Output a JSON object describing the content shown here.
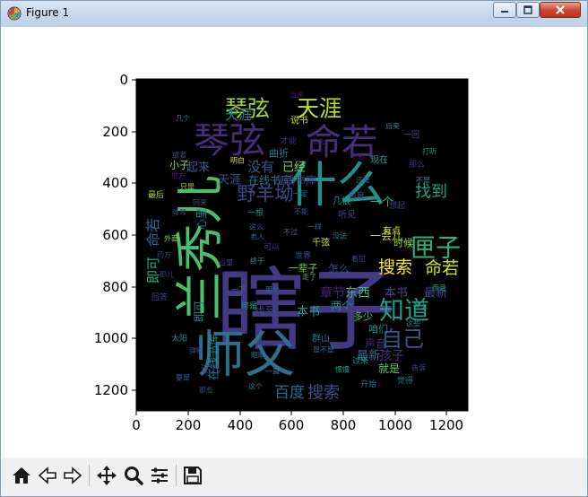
{
  "window": {
    "title": "Figure 1"
  },
  "plot": {
    "x_ticks": [
      "0",
      "200",
      "400",
      "600",
      "800",
      "1000",
      "1200"
    ],
    "y_ticks": [
      "0",
      "200",
      "400",
      "600",
      "800",
      "1000",
      "1200"
    ],
    "background": "#000000"
  },
  "toolbar": {
    "icons": [
      "home-icon",
      "back-arrow-icon",
      "forward-arrow-icon",
      "pan-icon",
      "zoom-icon",
      "configure-subplots-icon",
      "save-icon"
    ]
  },
  "wordcloud": {
    "words": [
      {
        "text": "瞎子",
        "color": "#443a83"
      },
      {
        "text": "师父",
        "color": "#2c728e"
      },
      {
        "text": "兰秀儿",
        "color": "#48c16e"
      },
      {
        "text": "什么",
        "color": "#21918c"
      },
      {
        "text": "琴弦",
        "color": "#472c7a"
      },
      {
        "text": "命若",
        "color": "#472d7b"
      },
      {
        "text": "琴弦",
        "color": "#a0da39"
      },
      {
        "text": "天涯",
        "color": "#c2df23"
      },
      {
        "text": "匣子",
        "color": "#2db27d"
      },
      {
        "text": "知道",
        "color": "#1f9e89"
      },
      {
        "text": "自己",
        "color": "#38588c"
      },
      {
        "text": "野羊坳",
        "color": "#3e4989"
      },
      {
        "text": "搜索",
        "color": "#fde725"
      },
      {
        "text": "命若",
        "color": "#d2e21b"
      },
      {
        "text": "没有",
        "color": "#365c8d"
      },
      {
        "text": "百度",
        "color": "#31688e"
      },
      {
        "text": "搜索",
        "color": "#3b528b"
      },
      {
        "text": "天涯",
        "color": "#26828e"
      },
      {
        "text": "命若",
        "color": "#32658e"
      },
      {
        "text": "在线书库",
        "color": "#2a788e"
      },
      {
        "text": "找到",
        "color": "#1fa187"
      },
      {
        "text": "本书",
        "color": "#404688"
      },
      {
        "text": "最新",
        "color": "#414487"
      },
      {
        "text": "章节",
        "color": "#482475"
      },
      {
        "text": "东西",
        "color": "#35b779"
      },
      {
        "text": "孩子",
        "color": "#46337e"
      },
      {
        "text": "一个",
        "color": "#2fb47c"
      },
      {
        "text": "即可",
        "color": "#27ad81"
      },
      {
        "text": "找到",
        "color": "#3f4788"
      },
      {
        "text": "本书",
        "color": "#1e9b8a"
      },
      {
        "text": "起来",
        "color": "#365d8d"
      },
      {
        "text": "天涯",
        "color": "#3a548c"
      },
      {
        "text": "在线书库",
        "color": "#25838e"
      },
      {
        "text": "已经",
        "color": "#7ad151"
      },
      {
        "text": "在线书库",
        "color": "#46307e"
      },
      {
        "text": "最新",
        "color": "#2e6f8e"
      },
      {
        "text": "一会儿",
        "color": "#bddf26"
      },
      {
        "text": "时候",
        "color": "#94d840"
      },
      {
        "text": "怎么",
        "color": "#3d4d8a"
      },
      {
        "text": "两个",
        "color": "#23898e"
      },
      {
        "text": "多少",
        "color": "#52c569"
      },
      {
        "text": "咱们",
        "color": "#1f948c"
      },
      {
        "text": "就是",
        "color": "#5ec962"
      },
      {
        "text": "声音",
        "color": "#482878"
      },
      {
        "text": "心里",
        "color": "#26818e"
      },
      {
        "text": "一辈子",
        "color": "#6ccd5a"
      },
      {
        "text": "曲折",
        "color": "#2a768e"
      },
      {
        "text": "这儿",
        "color": "#3e4a89"
      },
      {
        "text": "有点",
        "color": "#e7e419"
      },
      {
        "text": "一根",
        "color": "#20928c"
      },
      {
        "text": "现在",
        "color": "#1f978b"
      },
      {
        "text": "千弦",
        "color": "#dfe318"
      },
      {
        "text": "听见",
        "color": "#3f4889"
      },
      {
        "text": "想起",
        "color": "#443b84"
      },
      {
        "text": "小子",
        "color": "#89d548"
      },
      {
        "text": "说书",
        "color": "#b2dd2d"
      },
      {
        "text": "几根",
        "color": "#1f988b"
      },
      {
        "text": "一回",
        "color": "#3d4e8a"
      },
      {
        "text": "那么",
        "color": "#46327e"
      },
      {
        "text": "即可",
        "color": "#238a8d"
      },
      {
        "text": "群山",
        "color": "#2b758e"
      },
      {
        "text": "世界",
        "color": "#3b528b"
      },
      {
        "text": "才能",
        "color": "#472a7a"
      },
      {
        "text": "回答",
        "color": "#404588"
      },
      {
        "text": "可是",
        "color": "#1fa188"
      },
      {
        "text": "最后",
        "color": "#a8db34"
      },
      {
        "text": "太阳",
        "color": "#25858e"
      },
      {
        "text": "百度",
        "color": "#3e4c8a"
      },
      {
        "text": "过来",
        "color": "#1e9c89"
      },
      {
        "text": "开始",
        "color": "#2c728e"
      },
      {
        "text": "觉得",
        "color": "#29798e"
      },
      {
        "text": "可以",
        "color": "#472f7d"
      },
      {
        "text": "这么",
        "color": "#32648e"
      },
      {
        "text": "不能",
        "color": "#3c4f8a"
      },
      {
        "text": "这些",
        "color": "#238a8d"
      },
      {
        "text": "而且",
        "color": "#21a685"
      },
      {
        "text": "不过",
        "color": "#2e6e8e"
      },
      {
        "text": "要是",
        "color": "#355f8d"
      },
      {
        "text": "那儿",
        "color": "#453781"
      },
      {
        "text": "还是",
        "color": "#3b528b"
      },
      {
        "text": "不是",
        "color": "#1f958b"
      },
      {
        "text": "只是",
        "color": "#9bd93c"
      },
      {
        "text": "终于",
        "color": "#20a386"
      },
      {
        "text": "总之",
        "color": "#46337f"
      },
      {
        "text": "弹断",
        "color": "#3a548c"
      },
      {
        "text": "眼睛",
        "color": "#2d708e"
      },
      {
        "text": "晚上",
        "color": "#1fa088"
      },
      {
        "text": "山里",
        "color": "#3c4f8a"
      },
      {
        "text": "老人",
        "color": "#31668e"
      },
      {
        "text": "一样",
        "color": "#2b758e"
      },
      {
        "text": "没法",
        "color": "#27808e"
      },
      {
        "text": "地方",
        "color": "#481f70"
      },
      {
        "text": "走了",
        "color": "#4ac16d"
      },
      {
        "text": "慢慢",
        "color": "#22a884"
      },
      {
        "text": "看见",
        "color": "#3f4788"
      },
      {
        "text": "一定",
        "color": "#2c738e"
      },
      {
        "text": "明白",
        "color": "#d8e219"
      },
      {
        "text": "那个",
        "color": "#2a768e"
      },
      {
        "text": "药方",
        "color": "#404688"
      },
      {
        "text": "几个",
        "color": "#228c8d"
      },
      {
        "text": "出来",
        "color": "#471063"
      },
      {
        "text": "一下",
        "color": "#2d708e"
      },
      {
        "text": "回来",
        "color": "#3b528b"
      },
      {
        "text": "这个",
        "color": "#24868e"
      },
      {
        "text": "或者",
        "color": "#3d4d8a"
      },
      {
        "text": "那些",
        "color": "#3e4a89"
      },
      {
        "text": "打听",
        "color": "#1e9b8a"
      },
      {
        "text": "不知",
        "color": "#482677"
      },
      {
        "text": "后来",
        "color": "#25848e"
      },
      {
        "text": "外面",
        "color": "#7fd34e"
      },
      {
        "text": "一直",
        "color": "#287c8e"
      },
      {
        "text": "弹琴",
        "color": "#433d84"
      },
      {
        "text": "是不是",
        "color": "#2e6f8e"
      },
      {
        "text": "告诉",
        "color": "#3a548c"
      }
    ]
  }
}
